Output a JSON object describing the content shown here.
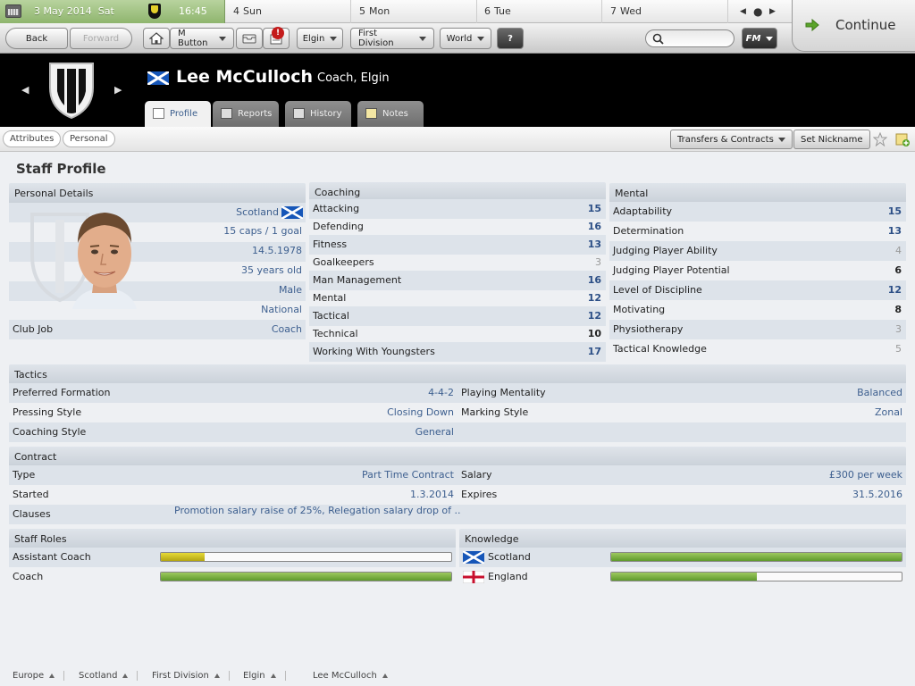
{
  "calendar": {
    "date": "3 May 2014",
    "weekday": "Sat",
    "time": "16:45",
    "days": [
      {
        "num": "4",
        "name": "Sun"
      },
      {
        "num": "5",
        "name": "Mon"
      },
      {
        "num": "6",
        "name": "Tue"
      },
      {
        "num": "7",
        "name": "Wed"
      }
    ],
    "accent": "#9bbf7a"
  },
  "toolbar": {
    "back": "Back",
    "forward": "Forward",
    "menu_button": "M Button",
    "notification_badge": "!",
    "club": "Elgin",
    "division": "First Division",
    "world": "World",
    "help": "?",
    "fm": "FM",
    "continue": "Continue"
  },
  "header": {
    "name": "Lee McCulloch",
    "role": "Coach, Elgin",
    "tabs": [
      "Profile",
      "Reports",
      "History",
      "Notes"
    ]
  },
  "subbar": {
    "pills": [
      "Attributes",
      "Personal"
    ],
    "transfers": "Transfers & Contracts",
    "nickname": "Set Nickname"
  },
  "page_title": "Staff Profile",
  "personal": {
    "title": "Personal Details",
    "nationality": "Scotland",
    "caps": "15 caps / 1 goal",
    "dob": "14.5.1978",
    "age": "35 years old",
    "gender": "Male",
    "reputation": "National",
    "club_job_label": "Club Job",
    "club_job": "Coach"
  },
  "coaching": {
    "title": "Coaching",
    "items": [
      {
        "label": "Attacking",
        "value": "15",
        "level": "high"
      },
      {
        "label": "Defending",
        "value": "16",
        "level": "top"
      },
      {
        "label": "Fitness",
        "value": "13",
        "level": "high"
      },
      {
        "label": "Goalkeepers",
        "value": "3",
        "level": "low"
      },
      {
        "label": "Man Management",
        "value": "16",
        "level": "top"
      },
      {
        "label": "Mental",
        "value": "12",
        "level": "high"
      },
      {
        "label": "Tactical",
        "value": "12",
        "level": "high"
      },
      {
        "label": "Technical",
        "value": "10",
        "level": "mid"
      },
      {
        "label": "Working With Youngsters",
        "value": "17",
        "level": "top"
      }
    ]
  },
  "mental": {
    "title": "Mental",
    "items": [
      {
        "label": "Adaptability",
        "value": "15",
        "level": "high"
      },
      {
        "label": "Determination",
        "value": "13",
        "level": "high"
      },
      {
        "label": "Judging Player Ability",
        "value": "4",
        "level": "low"
      },
      {
        "label": "Judging Player Potential",
        "value": "6",
        "level": "mid"
      },
      {
        "label": "Level of Discipline",
        "value": "12",
        "level": "high"
      },
      {
        "label": "Motivating",
        "value": "8",
        "level": "mid"
      },
      {
        "label": "Physiotherapy",
        "value": "3",
        "level": "low"
      },
      {
        "label": "Tactical Knowledge",
        "value": "5",
        "level": "low"
      }
    ]
  },
  "tactics": {
    "title": "Tactics",
    "preferred_formation_label": "Preferred Formation",
    "preferred_formation": "4-4-2",
    "pressing_label": "Pressing Style",
    "pressing": "Closing Down",
    "coaching_style_label": "Coaching Style",
    "coaching_style": "General",
    "mentality_label": "Playing Mentality",
    "mentality": "Balanced",
    "marking_label": "Marking Style",
    "marking": "Zonal"
  },
  "contract": {
    "title": "Contract",
    "type_label": "Type",
    "type": "Part Time Contract",
    "started_label": "Started",
    "started": "1.3.2014",
    "clauses_label": "Clauses",
    "clauses": "Promotion salary raise of 25%, Relegation salary drop of ..",
    "salary_label": "Salary",
    "salary": "£300 per week",
    "expires_label": "Expires",
    "expires": "31.5.2016"
  },
  "staff_roles": {
    "title": "Staff Roles",
    "items": [
      {
        "label": "Assistant Coach",
        "fraction": 0.15,
        "color": "yellow"
      },
      {
        "label": "Coach",
        "fraction": 1.0,
        "color": "green"
      }
    ]
  },
  "knowledge": {
    "title": "Knowledge",
    "items": [
      {
        "label": "Scotland",
        "fraction": 1.0,
        "flag": "scotland-flag-icon"
      },
      {
        "label": "England",
        "fraction": 0.5,
        "flag": "england-flag-icon"
      }
    ]
  },
  "breadcrumb": [
    "Europe",
    "Scotland",
    "First Division",
    "Elgin",
    "Lee McCulloch"
  ]
}
